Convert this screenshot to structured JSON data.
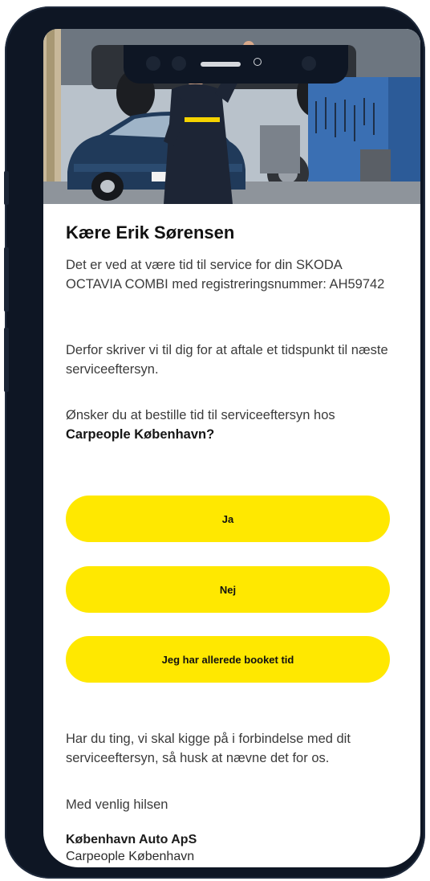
{
  "email": {
    "greeting": "Kære Erik Sørensen",
    "paragraph_1": "Det er ved at være tid til service for din SKODA OCTAVIA COMBI med registreringsnummer: AH59742",
    "paragraph_2": "Derfor skriver vi til dig for at aftale et tidspunkt til næste serviceeftersyn.",
    "paragraph_3_intro": "Ønsker du at bestille tid til serviceeftersyn hos",
    "paragraph_3_dealer": "Carpeople København?",
    "paragraph_4": "Har du ting, vi skal kigge på i forbindelse med dit serviceeftersyn, så husk at nævne det for os.",
    "closing": "Med venlig hilsen",
    "signature_company": "København Auto ApS",
    "signature_dealer": "Carpeople København"
  },
  "buttons": {
    "yes_label": "Ja",
    "no_label": "Nej",
    "already_booked_label": "Jeg har allerede booket tid"
  },
  "colors": {
    "button_bg": "#ffe800",
    "phone_frame": "#0e1624",
    "text": "#3b3b3b"
  }
}
